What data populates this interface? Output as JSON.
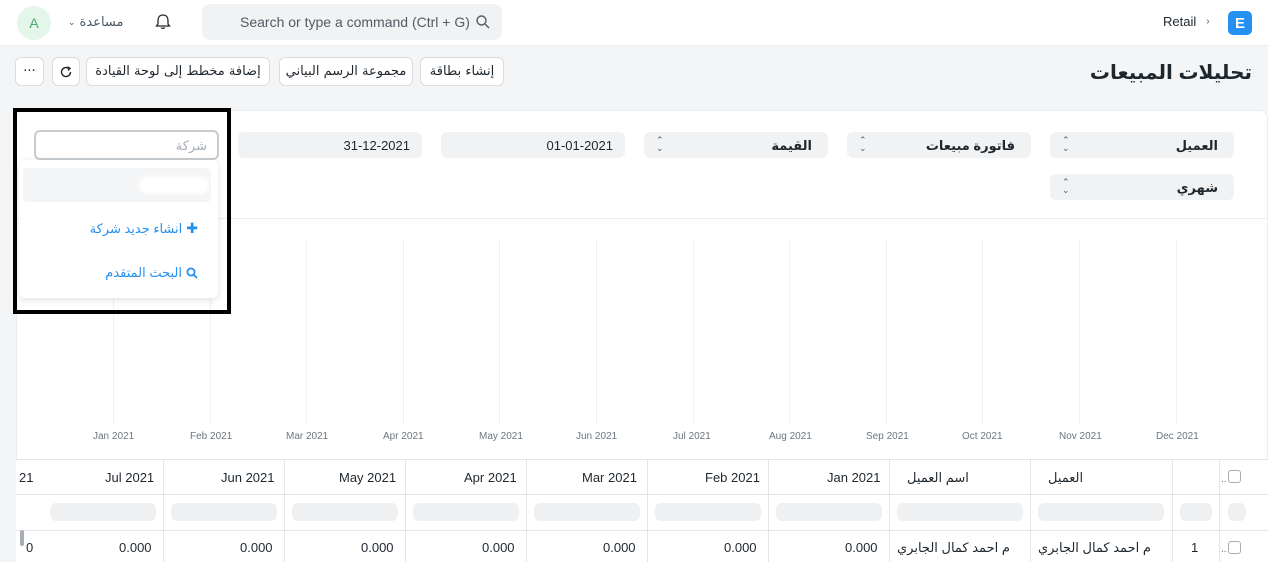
{
  "navbar": {
    "avatar_initial": "A",
    "help_label": "مساعدة",
    "search_placeholder": "Search or type a command (Ctrl + G)",
    "breadcrumb": "Retail",
    "logo_letter": "E"
  },
  "page": {
    "title": "تحليلات المبيعات",
    "buttons": {
      "more": "···",
      "add_to_dashboard": "إضافة مخطط إلى لوحة القيادة",
      "chart_group": "مجموعة الرسم البياني",
      "create_card": "إنشاء بطاقة"
    }
  },
  "filters": {
    "tree_type": "العميل",
    "doc_type": "فاتورة مبيعات",
    "value_quantity": "القيمة",
    "from_date": "01-01-2021",
    "to_date": "31-12-2021",
    "company_placeholder": "شركة",
    "range": "شهري"
  },
  "dropdown": {
    "create_new": "انشاء جديد شركة",
    "advanced_search": "البحث المتقدم"
  },
  "chart_data": {
    "type": "line",
    "x": [
      "Jan 2021",
      "Feb 2021",
      "Mar 2021",
      "Apr 2021",
      "May 2021",
      "Jun 2021",
      "Jul 2021",
      "Aug 2021",
      "Sep 2021",
      "Oct 2021",
      "Nov 2021",
      "Dec 2021"
    ],
    "series": [],
    "grid": true
  },
  "table": {
    "headers": {
      "customer": "العميل",
      "customer_name": "اسم العميل",
      "jan": "Jan 2021",
      "feb": "Feb 2021",
      "mar": "Mar 2021",
      "apr": "Apr 2021",
      "may": "May 2021",
      "jun": "Jun 2021",
      "jul": "Jul 2021",
      "aug_partial": "21"
    },
    "row": {
      "index": "1",
      "customer": "م احمد كمال الجابري",
      "customer_name": "م احمد كمال الجابري",
      "jan": "0.000",
      "feb": "0.000",
      "mar": "0.000",
      "apr": "0.000",
      "may": "0.000",
      "jun": "0.000",
      "jul": "0.000",
      "aug_partial": "0"
    }
  },
  "colors": {
    "accent": "#2490ef",
    "avatar_bg": "#e4f5e9",
    "avatar_fg": "#4aa96c"
  }
}
